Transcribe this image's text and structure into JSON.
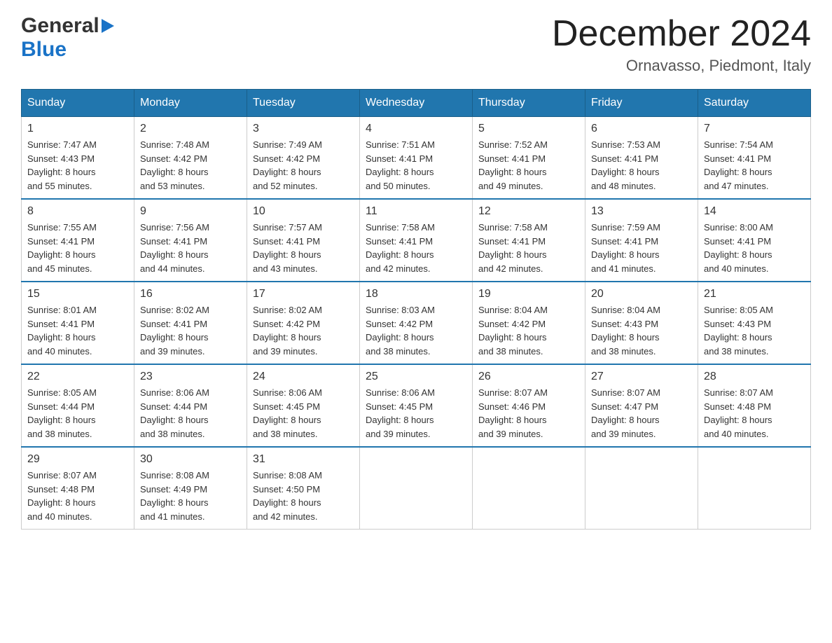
{
  "logo": {
    "general": "General",
    "blue": "Blue",
    "triangle": "▶"
  },
  "header": {
    "month": "December 2024",
    "location": "Ornavasso, Piedmont, Italy"
  },
  "weekdays": [
    "Sunday",
    "Monday",
    "Tuesday",
    "Wednesday",
    "Thursday",
    "Friday",
    "Saturday"
  ],
  "weeks": [
    [
      {
        "day": "1",
        "info": "Sunrise: 7:47 AM\nSunset: 4:43 PM\nDaylight: 8 hours\nand 55 minutes."
      },
      {
        "day": "2",
        "info": "Sunrise: 7:48 AM\nSunset: 4:42 PM\nDaylight: 8 hours\nand 53 minutes."
      },
      {
        "day": "3",
        "info": "Sunrise: 7:49 AM\nSunset: 4:42 PM\nDaylight: 8 hours\nand 52 minutes."
      },
      {
        "day": "4",
        "info": "Sunrise: 7:51 AM\nSunset: 4:41 PM\nDaylight: 8 hours\nand 50 minutes."
      },
      {
        "day": "5",
        "info": "Sunrise: 7:52 AM\nSunset: 4:41 PM\nDaylight: 8 hours\nand 49 minutes."
      },
      {
        "day": "6",
        "info": "Sunrise: 7:53 AM\nSunset: 4:41 PM\nDaylight: 8 hours\nand 48 minutes."
      },
      {
        "day": "7",
        "info": "Sunrise: 7:54 AM\nSunset: 4:41 PM\nDaylight: 8 hours\nand 47 minutes."
      }
    ],
    [
      {
        "day": "8",
        "info": "Sunrise: 7:55 AM\nSunset: 4:41 PM\nDaylight: 8 hours\nand 45 minutes."
      },
      {
        "day": "9",
        "info": "Sunrise: 7:56 AM\nSunset: 4:41 PM\nDaylight: 8 hours\nand 44 minutes."
      },
      {
        "day": "10",
        "info": "Sunrise: 7:57 AM\nSunset: 4:41 PM\nDaylight: 8 hours\nand 43 minutes."
      },
      {
        "day": "11",
        "info": "Sunrise: 7:58 AM\nSunset: 4:41 PM\nDaylight: 8 hours\nand 42 minutes."
      },
      {
        "day": "12",
        "info": "Sunrise: 7:58 AM\nSunset: 4:41 PM\nDaylight: 8 hours\nand 42 minutes."
      },
      {
        "day": "13",
        "info": "Sunrise: 7:59 AM\nSunset: 4:41 PM\nDaylight: 8 hours\nand 41 minutes."
      },
      {
        "day": "14",
        "info": "Sunrise: 8:00 AM\nSunset: 4:41 PM\nDaylight: 8 hours\nand 40 minutes."
      }
    ],
    [
      {
        "day": "15",
        "info": "Sunrise: 8:01 AM\nSunset: 4:41 PM\nDaylight: 8 hours\nand 40 minutes."
      },
      {
        "day": "16",
        "info": "Sunrise: 8:02 AM\nSunset: 4:41 PM\nDaylight: 8 hours\nand 39 minutes."
      },
      {
        "day": "17",
        "info": "Sunrise: 8:02 AM\nSunset: 4:42 PM\nDaylight: 8 hours\nand 39 minutes."
      },
      {
        "day": "18",
        "info": "Sunrise: 8:03 AM\nSunset: 4:42 PM\nDaylight: 8 hours\nand 38 minutes."
      },
      {
        "day": "19",
        "info": "Sunrise: 8:04 AM\nSunset: 4:42 PM\nDaylight: 8 hours\nand 38 minutes."
      },
      {
        "day": "20",
        "info": "Sunrise: 8:04 AM\nSunset: 4:43 PM\nDaylight: 8 hours\nand 38 minutes."
      },
      {
        "day": "21",
        "info": "Sunrise: 8:05 AM\nSunset: 4:43 PM\nDaylight: 8 hours\nand 38 minutes."
      }
    ],
    [
      {
        "day": "22",
        "info": "Sunrise: 8:05 AM\nSunset: 4:44 PM\nDaylight: 8 hours\nand 38 minutes."
      },
      {
        "day": "23",
        "info": "Sunrise: 8:06 AM\nSunset: 4:44 PM\nDaylight: 8 hours\nand 38 minutes."
      },
      {
        "day": "24",
        "info": "Sunrise: 8:06 AM\nSunset: 4:45 PM\nDaylight: 8 hours\nand 38 minutes."
      },
      {
        "day": "25",
        "info": "Sunrise: 8:06 AM\nSunset: 4:45 PM\nDaylight: 8 hours\nand 39 minutes."
      },
      {
        "day": "26",
        "info": "Sunrise: 8:07 AM\nSunset: 4:46 PM\nDaylight: 8 hours\nand 39 minutes."
      },
      {
        "day": "27",
        "info": "Sunrise: 8:07 AM\nSunset: 4:47 PM\nDaylight: 8 hours\nand 39 minutes."
      },
      {
        "day": "28",
        "info": "Sunrise: 8:07 AM\nSunset: 4:48 PM\nDaylight: 8 hours\nand 40 minutes."
      }
    ],
    [
      {
        "day": "29",
        "info": "Sunrise: 8:07 AM\nSunset: 4:48 PM\nDaylight: 8 hours\nand 40 minutes."
      },
      {
        "day": "30",
        "info": "Sunrise: 8:08 AM\nSunset: 4:49 PM\nDaylight: 8 hours\nand 41 minutes."
      },
      {
        "day": "31",
        "info": "Sunrise: 8:08 AM\nSunset: 4:50 PM\nDaylight: 8 hours\nand 42 minutes."
      },
      null,
      null,
      null,
      null
    ]
  ]
}
